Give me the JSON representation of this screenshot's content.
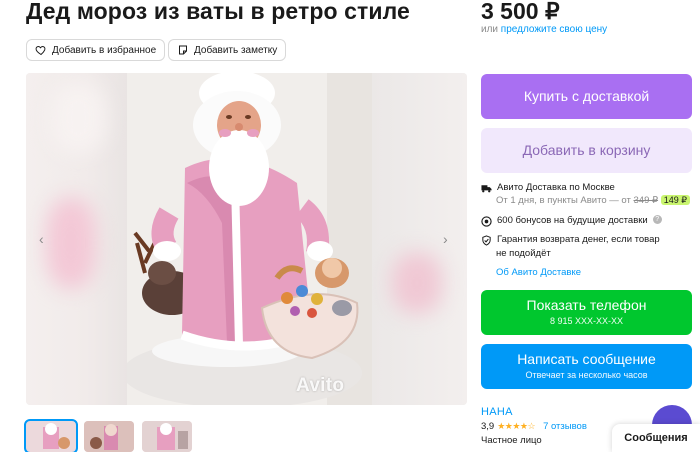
{
  "listing": {
    "title": "Дед мороз из ваты в ретро стиле",
    "price": "3 500 ₽",
    "price_sub_prefix": "или ",
    "price_sub_link": "предложите свою цену"
  },
  "actions": {
    "favorite": "Добавить в избранное",
    "note": "Добавить заметку"
  },
  "gallery": {
    "watermark": "Avito",
    "prev_icon": "chevron-left-icon",
    "next_icon": "chevron-right-icon",
    "thumbnails": [
      "thumb-1",
      "thumb-2",
      "thumb-3"
    ]
  },
  "buy": {
    "buy_label": "Купить с доставкой",
    "cart_label": "Добавить в корзину"
  },
  "delivery": {
    "title": "Авито Доставка по Москве",
    "sub_prefix": "От 1 дня, в пункты Авито — от ",
    "old_price": "349 ₽",
    "new_price": "149 ₽",
    "bonus": "600 бонусов на будущие доставки",
    "guarantee_line1": "Гарантия возврата денег, если товар",
    "guarantee_line2": "не подойдёт",
    "link": "Об Авито Доставке"
  },
  "contact": {
    "phone_label": "Показать телефон",
    "phone_number": "8 915 XXX-XX-XX",
    "message_label": "Написать сообщение",
    "message_sub": "Отвечает за несколько часов"
  },
  "seller": {
    "name": "НАНА",
    "rating": "3,9",
    "stars": "★★★★☆",
    "reviews": "7 отзывов",
    "type": "Частное лицо"
  },
  "chat": {
    "label": "Сообщения"
  },
  "colors": {
    "buy": "#a96ff2",
    "cart": "#f1e8fc",
    "phone": "#00c72e",
    "message": "#0099f7",
    "link": "#0099f7",
    "badge": "#c9f56f"
  }
}
